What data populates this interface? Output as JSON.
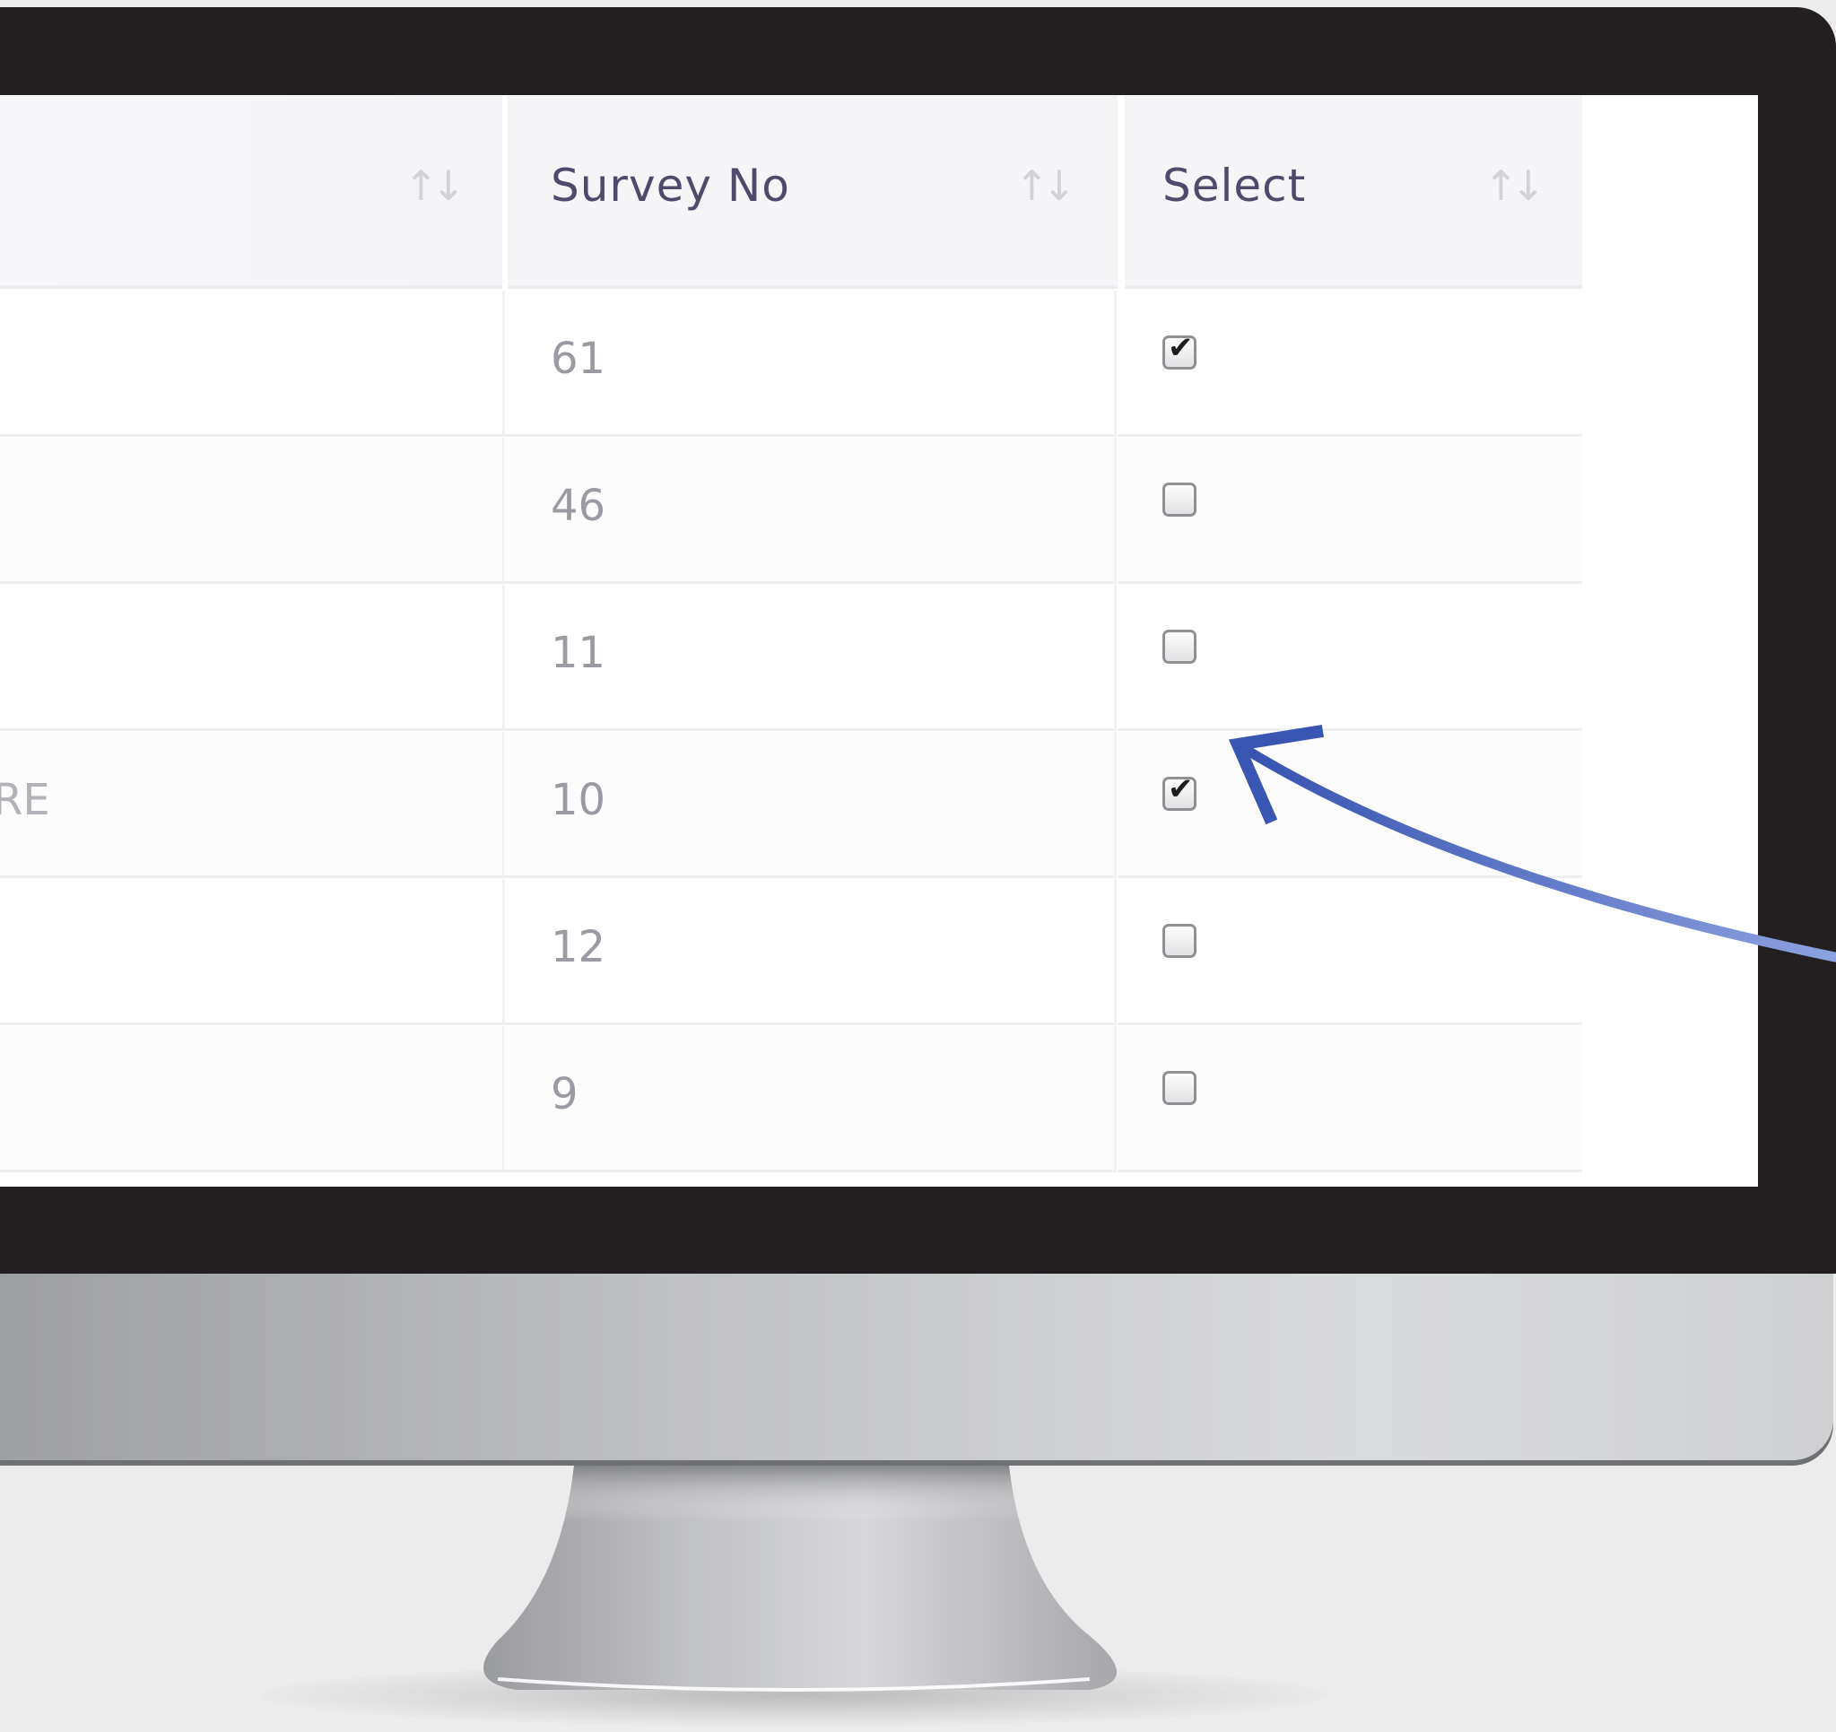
{
  "table": {
    "columns": [
      {
        "label": ""
      },
      {
        "label": "Survey No"
      },
      {
        "label": "Select"
      }
    ],
    "sort_icon": "↑↓",
    "rows": [
      {
        "partial_text": "",
        "survey_no": "61",
        "selected": true
      },
      {
        "partial_text": "",
        "survey_no": "46",
        "selected": false
      },
      {
        "partial_text": "",
        "survey_no": "11",
        "selected": false
      },
      {
        "partial_text": "RE",
        "survey_no": "10",
        "selected": true
      },
      {
        "partial_text": "",
        "survey_no": "12",
        "selected": false
      },
      {
        "partial_text": "",
        "survey_no": "9",
        "selected": false
      }
    ]
  },
  "checkmark": "✔",
  "annotation": {
    "icon": "arrow-icon",
    "color": "#3d5bb5"
  },
  "colors": {
    "header_bg": "#f5f5f8",
    "header_text": "#4f4a6b",
    "cell_text": "#9a9aa2",
    "bezel": "#231f20"
  }
}
